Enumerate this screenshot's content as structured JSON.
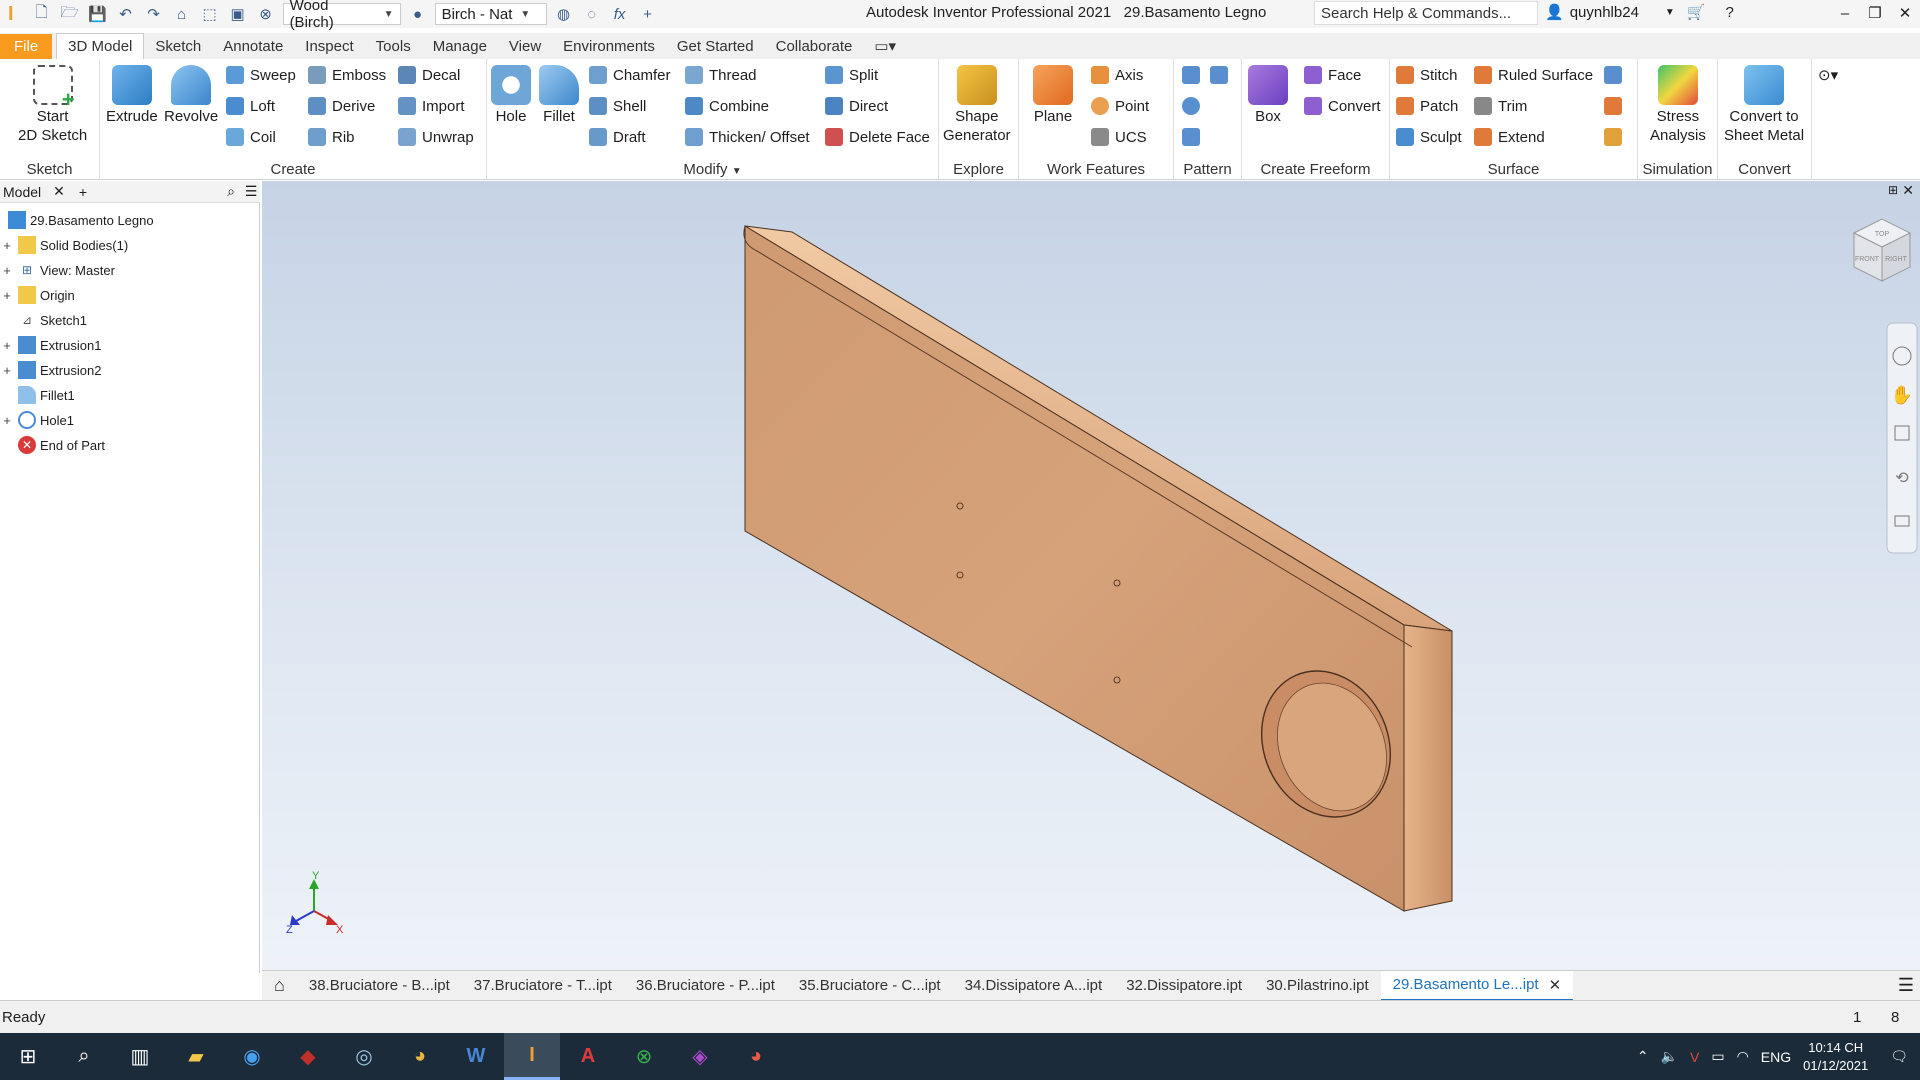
{
  "quick_access": {
    "material": "Wood (Birch)",
    "appearance": "Birch - Nat",
    "title": "Autodesk Inventor Professional 2021",
    "document": "29.Basamento Legno",
    "search_placeholder": "Search Help & Commands...",
    "user": "quynhlb24"
  },
  "tabs": [
    "File",
    "3D Model",
    "Sketch",
    "Annotate",
    "Inspect",
    "Tools",
    "Manage",
    "View",
    "Environments",
    "Get Started",
    "Collaborate"
  ],
  "active_tab": "3D Model",
  "ribbon": {
    "sketch": {
      "label": "Sketch",
      "start_line1": "Start",
      "start_line2": "2D Sketch"
    },
    "create": {
      "label": "Create",
      "extrude": "Extrude",
      "revolve": "Revolve",
      "sweep": "Sweep",
      "loft": "Loft",
      "coil": "Coil",
      "emboss": "Emboss",
      "derive": "Derive",
      "rib": "Rib",
      "decal": "Decal",
      "import": "Import",
      "unwrap": "Unwrap"
    },
    "modify": {
      "label": "Modify",
      "hole": "Hole",
      "fillet": "Fillet",
      "chamfer": "Chamfer",
      "shell": "Shell",
      "draft": "Draft",
      "thread": "Thread",
      "combine": "Combine",
      "thicken": "Thicken/ Offset",
      "split": "Split",
      "direct": "Direct",
      "delete_face": "Delete Face"
    },
    "explore": {
      "label": "Explore",
      "shape_line1": "Shape",
      "shape_line2": "Generator"
    },
    "work_features": {
      "label": "Work Features",
      "plane": "Plane",
      "axis": "Axis",
      "point": "Point",
      "ucs": "UCS"
    },
    "pattern": {
      "label": "Pattern"
    },
    "create_freeform": {
      "label": "Create Freeform",
      "box": "Box",
      "face": "Face",
      "convert": "Convert"
    },
    "surface": {
      "label": "Surface",
      "stitch": "Stitch",
      "patch": "Patch",
      "sculpt": "Sculpt",
      "ruled": "Ruled Surface",
      "trim": "Trim",
      "extend": "Extend"
    },
    "simulation": {
      "label": "Simulation",
      "stress_line1": "Stress",
      "stress_line2": "Analysis"
    },
    "convert": {
      "label": "Convert",
      "sheet_line1": "Convert to",
      "sheet_line2": "Sheet Metal"
    }
  },
  "browser": {
    "tab": "Model",
    "nodes": [
      "29.Basamento Legno",
      "Solid Bodies(1)",
      "View: Master",
      "Origin",
      "Sketch1",
      "Extrusion1",
      "Extrusion2",
      "Fillet1",
      "Hole1",
      "End of Part"
    ]
  },
  "viewcube": {
    "top": "TOP",
    "front": "FRONT",
    "right": "RIGHT"
  },
  "axes": {
    "x": "X",
    "y": "Y",
    "z": "Z"
  },
  "doc_tabs": [
    "38.Bruciatore - B...ipt",
    "37.Bruciatore - T...ipt",
    "36.Bruciatore - P...ipt",
    "35.Bruciatore - C...ipt",
    "34.Dissipatore A...ipt",
    "32.Dissipatore.ipt",
    "30.Pilastrino.ipt",
    "29.Basamento Le...ipt"
  ],
  "status": {
    "text": "Ready",
    "n1": "1",
    "n2": "8"
  },
  "taskbar": {
    "lang": "ENG",
    "time": "10:14 CH",
    "date": "01/12/2021"
  }
}
